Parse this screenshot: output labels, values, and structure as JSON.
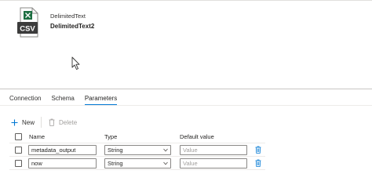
{
  "dataset": {
    "icon": "csv-file-icon",
    "icon_badge": "CSV",
    "type_label": "DelimitedText",
    "name": "DelimitedText2"
  },
  "tabs": [
    {
      "label": "Connection",
      "active": false
    },
    {
      "label": "Schema",
      "active": false
    },
    {
      "label": "Parameters",
      "active": true
    }
  ],
  "toolbar": {
    "new_label": "New",
    "delete_label": "Delete"
  },
  "grid": {
    "columns": {
      "name": "Name",
      "type": "Type",
      "default": "Default value"
    },
    "rows": [
      {
        "name": "metadata_output",
        "type": "String",
        "default_placeholder": "Value"
      },
      {
        "name": "now",
        "type": "String",
        "default_placeholder": "Value"
      }
    ]
  },
  "colors": {
    "accent": "#0078d4",
    "excel_green": "#1d6f42",
    "csv_badge": "#3c3c3c"
  }
}
